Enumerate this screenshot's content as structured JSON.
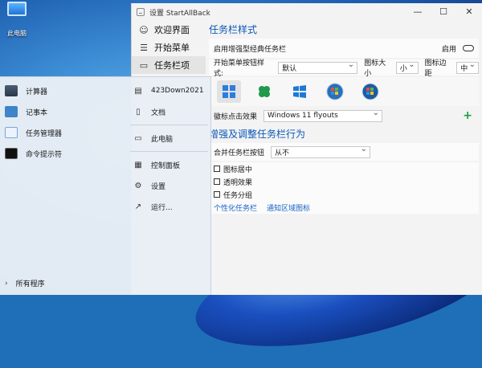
{
  "desktop": {
    "icon_label": "此电脑"
  },
  "window": {
    "title": "设置 StartAllBack",
    "controls": {
      "minimize": "—",
      "maximize": "☐",
      "close": "✕"
    }
  },
  "sidebar": {
    "items": [
      {
        "label": "欢迎界面",
        "icon": "smile-icon"
      },
      {
        "label": "开始菜单",
        "icon": "menu-icon"
      },
      {
        "label": "任务栏项",
        "icon": "taskbar-icon"
      }
    ]
  },
  "taskbar_style": {
    "title": "任务栏样式",
    "classic_row": {
      "label": "启用增强型经典任务栏",
      "toggle_label": "启用"
    },
    "start_button_style": {
      "label": "开始菜单按钮样式:",
      "value": "默认"
    },
    "icon_size": {
      "label": "图标大小",
      "value": "小"
    },
    "icon_margin": {
      "label": "图标边距",
      "value": "中"
    },
    "click_effect": {
      "label": "徽标点击效果",
      "value": "Windows 11 flyouts"
    },
    "add_icon": "+"
  },
  "behavior": {
    "title": "增强及调整任务栏行为",
    "combine": {
      "label": "合并任务栏按钮",
      "value": "从不"
    },
    "checkboxes": [
      "图标居中",
      "透明效果",
      "任务分组"
    ],
    "links": [
      "个性化任务栏",
      "通知区域图标"
    ]
  },
  "startmenu": {
    "apps": [
      {
        "label": "计算器",
        "icon": "calculator-icon"
      },
      {
        "label": "记事本",
        "icon": "notepad-icon"
      },
      {
        "label": "任务管理器",
        "icon": "task-manager-icon"
      },
      {
        "label": "命令提示符",
        "icon": "command-prompt-icon"
      }
    ],
    "all_programs": "所有程序",
    "right_links": [
      {
        "label": "423Down2021",
        "icon": "user-folder-icon"
      },
      {
        "label": "文档",
        "icon": "document-icon"
      },
      {
        "label": "此电脑",
        "icon": "computer-icon"
      },
      {
        "label": "控制面板",
        "icon": "control-panel-icon"
      },
      {
        "label": "设置",
        "icon": "gear-icon"
      },
      {
        "label": "运行...",
        "icon": "run-icon"
      }
    ]
  }
}
